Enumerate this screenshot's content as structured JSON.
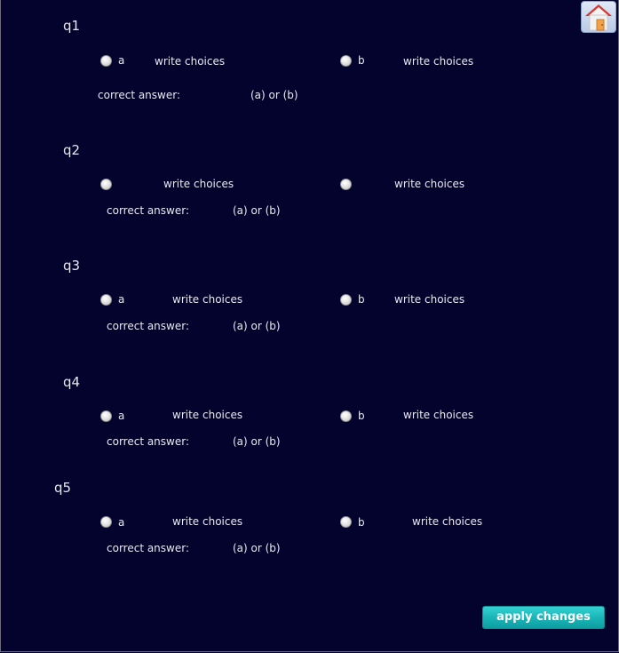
{
  "questions": [
    {
      "label": "q1",
      "opt_a": "a",
      "opt_b": "b",
      "choice_a": "write choices",
      "choice_b": "write choices",
      "correct_label": "correct answer:",
      "correct_value": "(a) or (b)"
    },
    {
      "label": "q2",
      "opt_a": "",
      "opt_b": "",
      "choice_a": "write choices",
      "choice_b": "write choices",
      "correct_label": "correct answer:",
      "correct_value": "(a) or (b)"
    },
    {
      "label": "q3",
      "opt_a": "a",
      "opt_b": "b",
      "choice_a": "write choices",
      "choice_b": "write choices",
      "correct_label": "correct answer:",
      "correct_value": "(a) or (b)"
    },
    {
      "label": "q4",
      "opt_a": "a",
      "opt_b": "b",
      "choice_a": "write choices",
      "choice_b": "write choices",
      "correct_label": "correct answer:",
      "correct_value": "(a) or (b)"
    },
    {
      "label": "q5",
      "opt_a": "a",
      "opt_b": "b",
      "choice_a": "write choices",
      "choice_b": "write choices",
      "correct_label": "correct answer:",
      "correct_value": "(a) or (b)"
    }
  ],
  "buttons": {
    "apply_label": "apply changes"
  },
  "icons": {
    "home": "home-icon"
  },
  "colors": {
    "background": "#03032e",
    "accent": "#19b2b6"
  }
}
